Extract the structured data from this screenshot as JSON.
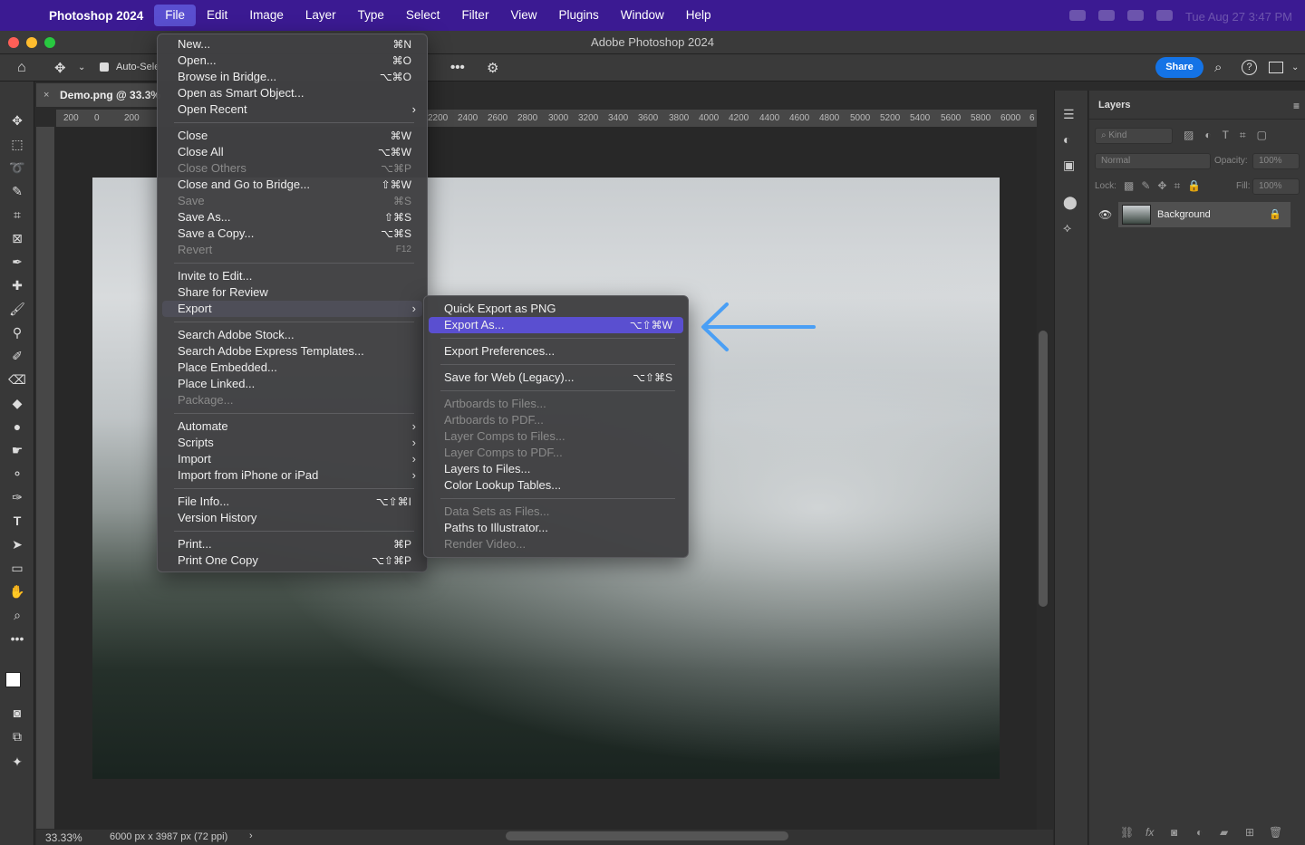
{
  "menubar": {
    "app_name": "Photoshop 2024",
    "items": [
      "File",
      "Edit",
      "Image",
      "Layer",
      "Type",
      "Select",
      "Filter",
      "View",
      "Plugins",
      "Window",
      "Help"
    ],
    "clock": "Tue Aug 27  3:47 PM"
  },
  "window": {
    "title": "Adobe Photoshop 2024"
  },
  "options": {
    "auto_select_label": "Auto-Sele",
    "share_label": "Share"
  },
  "document": {
    "tab_label": "Demo.png @ 33.3%"
  },
  "ruler": {
    "left_labels": [
      "200",
      "0",
      "200"
    ],
    "right_labels": [
      "2200",
      "2400",
      "2600",
      "2800",
      "3000",
      "3200",
      "3400",
      "3600",
      "3800",
      "4000",
      "4200",
      "4400",
      "4600",
      "4800",
      "5000",
      "5200",
      "5400",
      "5600",
      "5800",
      "6000",
      "6"
    ]
  },
  "statusbar": {
    "zoom": "33.33%",
    "info": "6000 px x 3987 px (72 ppi)",
    "arrow": "›"
  },
  "layers_panel": {
    "tab": "Layers",
    "kind_placeholder": "Kind",
    "blend_mode": "Normal",
    "opacity_label": "Opacity:",
    "opacity_value": "100%",
    "lock_label": "Lock:",
    "fill_label": "Fill:",
    "fill_value": "100%",
    "layer_name": "Background"
  },
  "file_menu": [
    {
      "label": "New...",
      "shortcut": "⌘N"
    },
    {
      "label": "Open...",
      "shortcut": "⌘O"
    },
    {
      "label": "Browse in Bridge...",
      "shortcut": "⌥⌘O"
    },
    {
      "label": "Open as Smart Object...",
      "shortcut": ""
    },
    {
      "label": "Open Recent",
      "shortcut": "",
      "submenu": true
    },
    {
      "label": "Close",
      "shortcut": "⌘W"
    },
    {
      "label": "Close All",
      "shortcut": "⌥⌘W"
    },
    {
      "label": "Close Others",
      "shortcut": "⌥⌘P",
      "disabled": true
    },
    {
      "label": "Close and Go to Bridge...",
      "shortcut": "⇧⌘W"
    },
    {
      "label": "Save",
      "shortcut": "⌘S",
      "disabled": true
    },
    {
      "label": "Save As...",
      "shortcut": "⇧⌘S"
    },
    {
      "label": "Save a Copy...",
      "shortcut": "⌥⌘S"
    },
    {
      "label": "Revert",
      "shortcut": "F12",
      "disabled": true
    },
    {
      "label": "Invite to Edit...",
      "shortcut": ""
    },
    {
      "label": "Share for Review",
      "shortcut": ""
    },
    {
      "label": "Export",
      "shortcut": "",
      "submenu": true,
      "highlighted": true
    },
    {
      "label": "Search Adobe Stock...",
      "shortcut": ""
    },
    {
      "label": "Search Adobe Express Templates...",
      "shortcut": ""
    },
    {
      "label": "Place Embedded...",
      "shortcut": ""
    },
    {
      "label": "Place Linked...",
      "shortcut": ""
    },
    {
      "label": "Package...",
      "shortcut": "",
      "disabled": true
    },
    {
      "label": "Automate",
      "shortcut": "",
      "submenu": true
    },
    {
      "label": "Scripts",
      "shortcut": "",
      "submenu": true
    },
    {
      "label": "Import",
      "shortcut": "",
      "submenu": true
    },
    {
      "label": "Import from iPhone or iPad",
      "shortcut": "",
      "submenu": true
    },
    {
      "label": "File Info...",
      "shortcut": "⌥⇧⌘I"
    },
    {
      "label": "Version History",
      "shortcut": ""
    },
    {
      "label": "Print...",
      "shortcut": "⌘P"
    },
    {
      "label": "Print One Copy",
      "shortcut": "⌥⇧⌘P"
    }
  ],
  "export_menu": [
    {
      "label": "Quick Export as PNG",
      "shortcut": ""
    },
    {
      "label": "Export As...",
      "shortcut": "⌥⇧⌘W",
      "highlighted": true
    },
    {
      "label": "Export Preferences...",
      "shortcut": ""
    },
    {
      "label": "Save for Web (Legacy)...",
      "shortcut": "⌥⇧⌘S"
    },
    {
      "label": "Artboards to Files...",
      "shortcut": "",
      "disabled": true
    },
    {
      "label": "Artboards to PDF...",
      "shortcut": "",
      "disabled": true
    },
    {
      "label": "Layer Comps to Files...",
      "shortcut": "",
      "disabled": true
    },
    {
      "label": "Layer Comps to PDF...",
      "shortcut": "",
      "disabled": true
    },
    {
      "label": "Layers to Files...",
      "shortcut": ""
    },
    {
      "label": "Color Lookup Tables...",
      "shortcut": ""
    },
    {
      "label": "Data Sets as Files...",
      "shortcut": "",
      "disabled": true
    },
    {
      "label": "Paths to Illustrator...",
      "shortcut": ""
    },
    {
      "label": "Render Video...",
      "shortcut": "",
      "disabled": true
    }
  ],
  "annotation": {
    "arrow_color": "#4a9ff5"
  }
}
